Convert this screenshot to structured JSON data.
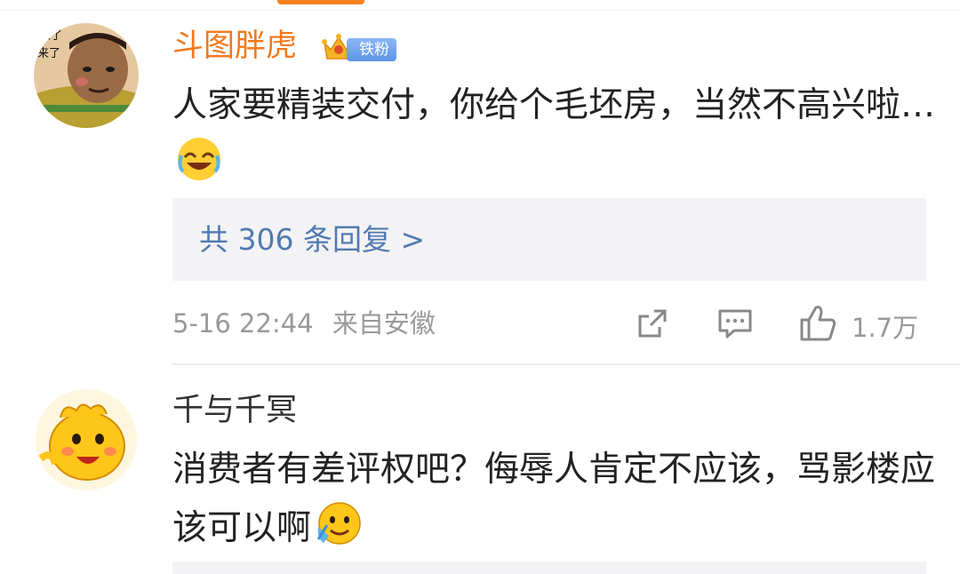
{
  "comments": [
    {
      "username": "斗图胖虎",
      "fan_badge": "铁粉",
      "text": "人家要精装交付，你给个毛坯房，当然不高兴啦…",
      "replies_link": "共 306 条回复 >",
      "date": "5-16 22:44",
      "source": "来自安徽",
      "likes": "1.7万",
      "avatar_text": "来了\n来了",
      "emoji": "laugh-cry-emoji"
    },
    {
      "username": "千与千冥",
      "text": "消费者有差评权吧？侮辱人肯定不应该，骂影楼应该可以啊",
      "emoji": "crying-smile-emoji"
    }
  ],
  "colors": {
    "vip_name": "#f2791f",
    "reply_link": "#517ab0",
    "meta": "#999999",
    "badge": "#6a9eee"
  },
  "icons": [
    "share-icon",
    "comment-icon",
    "like-icon",
    "crown-icon"
  ]
}
